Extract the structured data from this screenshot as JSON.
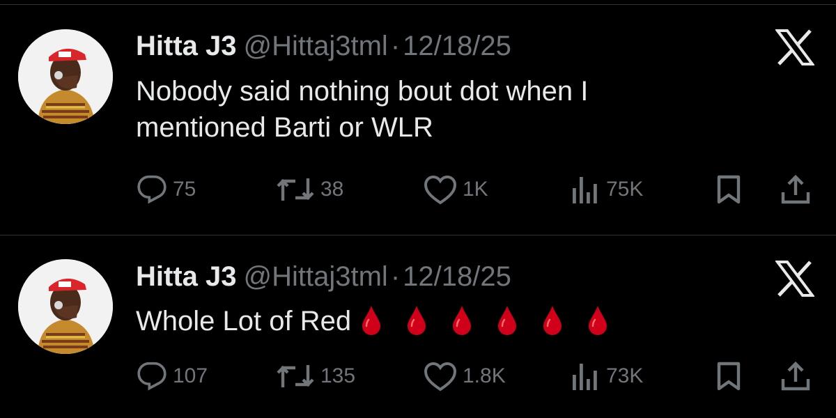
{
  "tweets": [
    {
      "name": "Hitta J3",
      "handle": "@Hittaj3tml",
      "separator": "·",
      "date": "12/18/25",
      "text_lines": [
        "Nobody said nothing bout dot when I",
        "mentioned Barti or WLR"
      ],
      "emoji_count": 0,
      "stats": {
        "replies": "75",
        "reposts": "38",
        "likes": "1K",
        "views": "75K"
      }
    },
    {
      "name": "Hitta J3",
      "handle": "@Hittaj3tml",
      "separator": "·",
      "date": "12/18/25",
      "text_lines": [
        "Whole Lot of Red"
      ],
      "emoji_count": 6,
      "emoji": "drop-of-blood",
      "stats": {
        "replies": "107",
        "reposts": "135",
        "likes": "1.8K",
        "views": "73K"
      }
    }
  ],
  "icons": {
    "platform_logo": "x-logo-icon",
    "reply": "reply-icon",
    "repost": "repost-icon",
    "like": "heart-icon",
    "views": "views-icon",
    "bookmark": "bookmark-icon",
    "share": "share-icon"
  },
  "colors": {
    "background": "#000000",
    "primary_text": "#e7e9ea",
    "secondary_text": "#71767b",
    "divider": "#2f3336",
    "drop_red": "#d0001a"
  }
}
